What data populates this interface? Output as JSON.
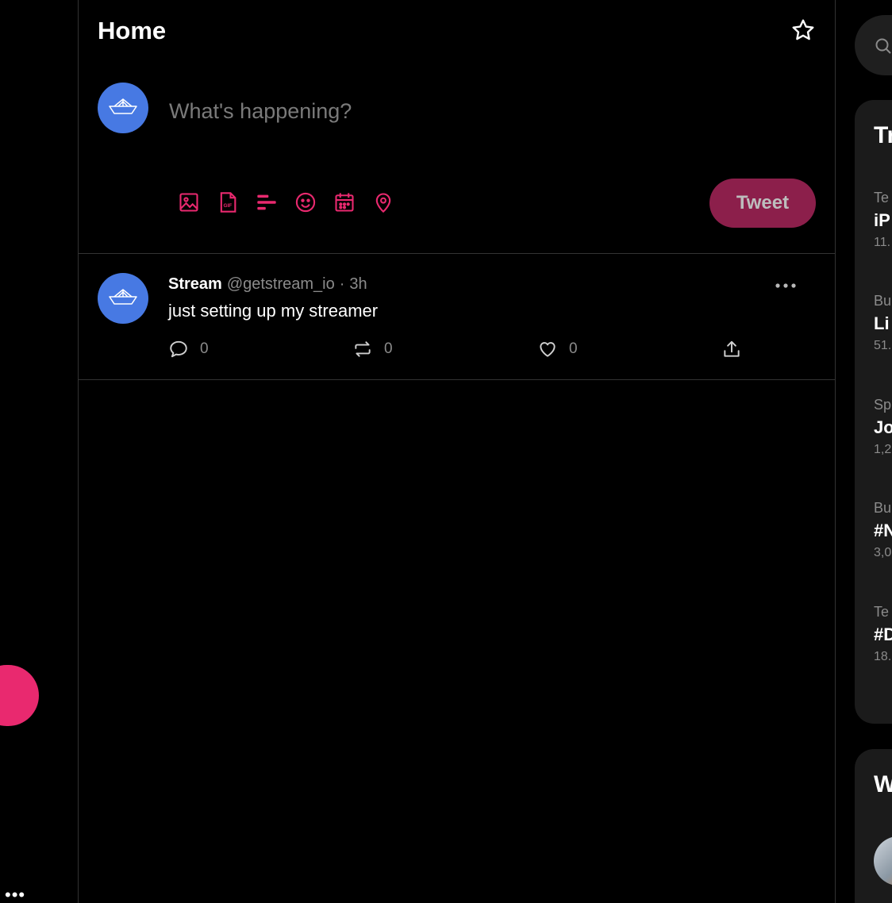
{
  "header": {
    "title": "Home",
    "star_icon": "star-outline-icon"
  },
  "composer": {
    "placeholder": "What's happening?",
    "avatar_icon": "paper-boat-icon",
    "tools": [
      "image-icon",
      "gif-icon",
      "poll-icon",
      "emoji-icon",
      "schedule-icon",
      "location-icon"
    ],
    "tweet_label": "Tweet",
    "accent": "#e9296f",
    "tweet_button_color": "#8c1f4b"
  },
  "tweet": {
    "author_name": "Stream",
    "handle": "@getstream_io",
    "separator": "·",
    "time": "3h",
    "text": "just setting up my streamer",
    "more_label": "•••",
    "actions": [
      {
        "icon": "reply-icon",
        "count": "0"
      },
      {
        "icon": "retweet-icon",
        "count": "0"
      },
      {
        "icon": "like-icon",
        "count": "0"
      },
      {
        "icon": "share-icon",
        "count": ""
      }
    ]
  },
  "sidebar": {
    "more_label": "•••"
  },
  "right": {
    "trends_title": "Tr",
    "trends": [
      {
        "category": "Te",
        "name": "iP",
        "count": "11."
      },
      {
        "category": "Bu",
        "name": "Li",
        "count": "51."
      },
      {
        "category": "Sp",
        "name": "Jo",
        "count": "1,2"
      },
      {
        "category": "Bu",
        "name": "#N",
        "count": "3,0"
      },
      {
        "category": "Te",
        "name": "#D",
        "count": "18."
      }
    ],
    "who_title": "W"
  }
}
